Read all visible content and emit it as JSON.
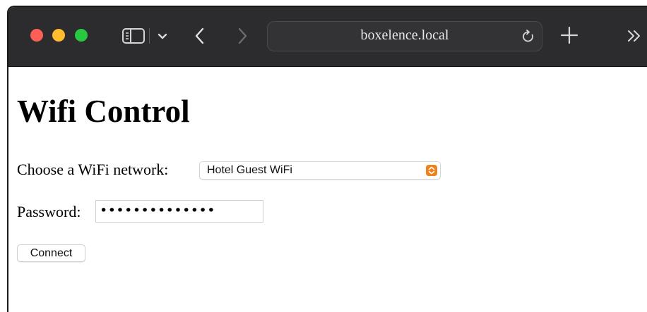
{
  "browser": {
    "url": "boxelence.local",
    "icons": {
      "close": "close-window-icon",
      "minimize": "minimize-window-icon",
      "zoom": "zoom-window-icon",
      "sidebar": "sidebar-icon",
      "tab_overview": "chevron-down-icon",
      "back": "back-arrow-icon",
      "forward": "forward-arrow-icon",
      "reload": "reload-icon",
      "new_tab": "plus-icon",
      "more": "double-chevron-right-icon"
    },
    "colors": {
      "toolbar_bg": "#2c2c2e",
      "traffic_red": "#ff5f57",
      "traffic_yellow": "#febc2e",
      "traffic_green": "#28c840"
    }
  },
  "page": {
    "title": "Wifi Control",
    "network_label": "Choose a WiFi network:",
    "network_selected": "Hotel Guest WiFi",
    "password_label": "Password:",
    "password_value": "••••••••••••••",
    "connect_label": "Connect",
    "colors": {
      "select_accent": "#f0821e"
    }
  }
}
